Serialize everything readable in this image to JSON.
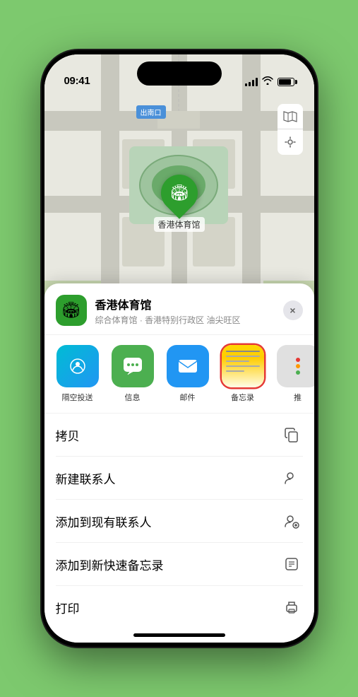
{
  "status_bar": {
    "time": "09:41",
    "location_arrow": "▲"
  },
  "map": {
    "south_exit_label": "南口",
    "south_exit_prefix": "出",
    "marker_label": "香港体育馆",
    "controls": {
      "map_icon": "🗺",
      "location_icon": "⊿"
    }
  },
  "bottom_sheet": {
    "venue_icon": "🏟",
    "venue_name": "香港体育馆",
    "venue_subtitle": "综合体育馆 · 香港特别行政区 油尖旺区",
    "close_label": "×"
  },
  "share_row": {
    "items": [
      {
        "id": "airdrop",
        "label": "隔空投送",
        "type": "airdrop"
      },
      {
        "id": "messages",
        "label": "信息",
        "type": "messages"
      },
      {
        "id": "mail",
        "label": "邮件",
        "type": "mail"
      },
      {
        "id": "notes",
        "label": "备忘录",
        "type": "notes"
      },
      {
        "id": "more",
        "label": "推",
        "type": "more"
      }
    ]
  },
  "actions": [
    {
      "id": "copy",
      "label": "拷贝",
      "icon": "copy"
    },
    {
      "id": "new-contact",
      "label": "新建联系人",
      "icon": "person-add"
    },
    {
      "id": "add-existing",
      "label": "添加到现有联系人",
      "icon": "person-plus"
    },
    {
      "id": "add-notes",
      "label": "添加到新快速备忘录",
      "icon": "note"
    },
    {
      "id": "print",
      "label": "打印",
      "icon": "printer"
    }
  ]
}
